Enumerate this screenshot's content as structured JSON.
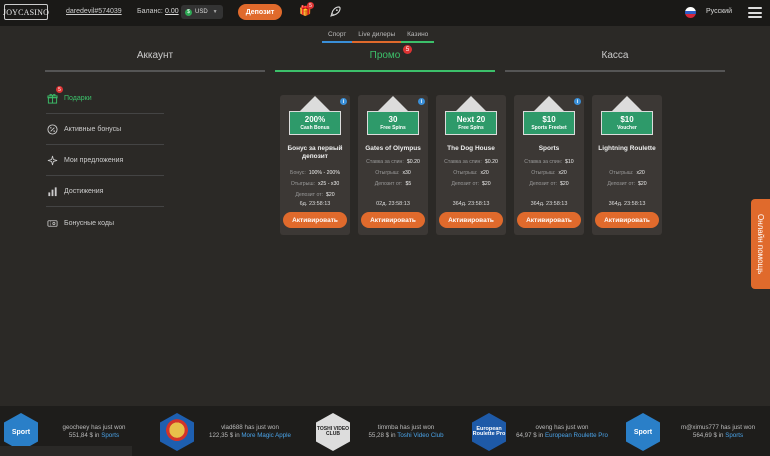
{
  "header": {
    "logo_text": "JOYCASINO",
    "username": "daredevil#574039",
    "balance_label": "Баланс:",
    "balance_value": "0.00",
    "currency": "USD",
    "currency_icon": "dollar-coin-icon",
    "deposit_label": "Депозит",
    "gifts_badge": "5",
    "language": "Русский",
    "accent_color": "#e06a2c"
  },
  "subnav": {
    "items": [
      {
        "label": "Спорт",
        "color": "#3a8fd8"
      },
      {
        "label": "Live дилеры",
        "color": "#e06a2c"
      },
      {
        "label": "Казино",
        "color": "#3cc06a"
      }
    ]
  },
  "tabs": {
    "account": "Аккаунт",
    "promo": "Промо",
    "promo_badge": "5",
    "cashier": "Касса",
    "active_color": "#3cc06a"
  },
  "sidebar": {
    "items": [
      {
        "label": "Подарки",
        "icon": "gift-icon",
        "badge": "5",
        "active": true
      },
      {
        "label": "Активные бонусы",
        "icon": "percent-badge-icon"
      },
      {
        "label": "Мои предложения",
        "icon": "sparkle-icon"
      },
      {
        "label": "Достижения",
        "icon": "bar-chart-icon"
      },
      {
        "label": "Бонусные коды",
        "icon": "promo-code-icon"
      }
    ]
  },
  "cards": [
    {
      "badge_main": "200%",
      "badge_sub": "Cash Bonus",
      "title": "Бонус за первый депозит",
      "has_info": true,
      "rows": [
        {
          "k": "Бонус:",
          "v": "100% - 200%"
        },
        {
          "k": "Отыгрыш:",
          "v": "x25 - x30"
        },
        {
          "k": "Депозит от:",
          "v": "$20"
        }
      ],
      "timer": "6д. 23:58:13",
      "button": "Активировать"
    },
    {
      "badge_main": "30",
      "badge_sub": "Free Spins",
      "title": "Gates of Olympus",
      "has_info": true,
      "rows": [
        {
          "k": "Ставка за спин:",
          "v": "$0.20"
        },
        {
          "k": "Отыгрыш:",
          "v": "x30"
        },
        {
          "k": "Депозит от:",
          "v": "$5"
        }
      ],
      "timer": "02д. 23:58:13",
      "button": "Активировать"
    },
    {
      "badge_main": "Next 20",
      "badge_sub": "Free Spins",
      "title": "The Dog House",
      "has_info": false,
      "rows": [
        {
          "k": "Ставка за спин:",
          "v": "$0.20"
        },
        {
          "k": "Отыгрыш:",
          "v": "x20"
        },
        {
          "k": "Депозит от:",
          "v": "$20"
        }
      ],
      "timer": "364д. 23:58:13",
      "button": "Активировать"
    },
    {
      "badge_main": "$10",
      "badge_sub": "Sports Freebet",
      "title": "Sports",
      "has_info": true,
      "rows": [
        {
          "k": "Ставка за спин:",
          "v": "$10"
        },
        {
          "k": "Отыгрыш:",
          "v": "x20"
        },
        {
          "k": "Депозит от:",
          "v": "$20"
        }
      ],
      "timer": "364д. 23:58:13",
      "button": "Активировать"
    },
    {
      "badge_main": "$10",
      "badge_sub": "Voucher",
      "title": "Lightning Roulette",
      "has_info": false,
      "rows": [
        {
          "k": "Отыгрыш:",
          "v": "x20"
        },
        {
          "k": "Депозит от:",
          "v": "$20"
        }
      ],
      "timer": "364д. 23:58:13",
      "button": "Активировать"
    }
  ],
  "help_tab": "Онлайн помощь",
  "winners": [
    {
      "user": "geocheey",
      "verb": "has just won",
      "amount": "551,84 $ in",
      "game": "Sports",
      "icon_text": "Sport",
      "icon_color": "#2a7fc8"
    },
    {
      "user": "vlad688",
      "verb": "has just won",
      "amount": "122,35 $ in",
      "game": "More Magic Apple",
      "icon_text": "",
      "icon_color": "#1e5fb0"
    },
    {
      "user": "timmba",
      "verb": "has just won",
      "amount": "55,28 $ in",
      "game": "Toshi Video Club",
      "icon_text": "TOSHI VIDEO CLUB",
      "icon_color": "#dddddd"
    },
    {
      "user": "oveng",
      "verb": "has just won",
      "amount": "64,97 $ in",
      "game": "European Roulette Pro",
      "icon_text": "European Roulette Pro",
      "icon_color": "#1e5aa8"
    },
    {
      "user": "m@ximus777",
      "verb": "has just won",
      "amount": "564,69 $ in",
      "game": "Sports",
      "icon_text": "Sport",
      "icon_color": "#2a7fc8"
    }
  ]
}
